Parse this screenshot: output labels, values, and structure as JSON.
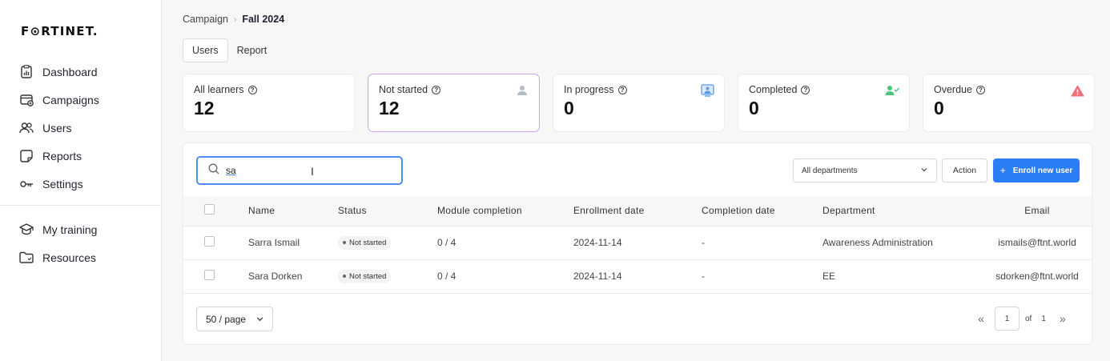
{
  "brand": {
    "logo_text": "F⊙RTINET."
  },
  "sidebar": {
    "items": [
      {
        "label": "Dashboard",
        "icon": "dashboard-icon"
      },
      {
        "label": "Campaigns",
        "icon": "campaigns-icon"
      },
      {
        "label": "Users",
        "icon": "users-icon"
      },
      {
        "label": "Reports",
        "icon": "reports-icon"
      },
      {
        "label": "Settings",
        "icon": "settings-key-icon"
      }
    ],
    "secondary": [
      {
        "label": "My training",
        "icon": "graduation-cap-icon"
      },
      {
        "label": "Resources",
        "icon": "folder-icon"
      }
    ]
  },
  "breadcrumb": {
    "parent": "Campaign",
    "separator": "›",
    "current": "Fall 2024"
  },
  "tabs": [
    {
      "label": "Users"
    },
    {
      "label": "Report"
    }
  ],
  "stats": [
    {
      "label": "All learners",
      "value": "12",
      "icon": ""
    },
    {
      "label": "Not started",
      "value": "12",
      "icon": "user-icon"
    },
    {
      "label": "In progress",
      "value": "0",
      "icon": "presentation-icon"
    },
    {
      "label": "Completed",
      "value": "0",
      "icon": "user-check-icon"
    },
    {
      "label": "Overdue",
      "value": "0",
      "icon": "warning-icon"
    }
  ],
  "colors": {
    "accent": "#2a7ef6",
    "selected_card_border": "#c8a6ee",
    "completed_icon": "#4cc47a",
    "overdue_icon": "#f0707a",
    "in_progress_icon": "#5b9be8"
  },
  "toolbar": {
    "search_value": "sa",
    "department_select": "All departments",
    "action_label": "Action",
    "enroll_label": "Enroll new user",
    "enroll_icon": "+"
  },
  "table": {
    "headers": [
      "Name",
      "Status",
      "Module completion",
      "Enrollment date",
      "Completion date",
      "Department",
      "Email"
    ],
    "rows": [
      {
        "name": "Sarra Ismail",
        "status": "Not started",
        "module": "0 / 4",
        "enrolled": "2024-11-14",
        "completed": "-",
        "department": "Awareness Administration",
        "email": "ismails@ftnt.world"
      },
      {
        "name": "Sara Dorken",
        "status": "Not started",
        "module": "0 / 4",
        "enrolled": "2024-11-14",
        "completed": "-",
        "department": "EE",
        "email": "sdorken@ftnt.world"
      }
    ]
  },
  "pagination": {
    "per_page": "50 / page",
    "current_page": "1",
    "of_label": "of",
    "total_pages": "1",
    "first_icon": "«",
    "last_icon": "»"
  }
}
